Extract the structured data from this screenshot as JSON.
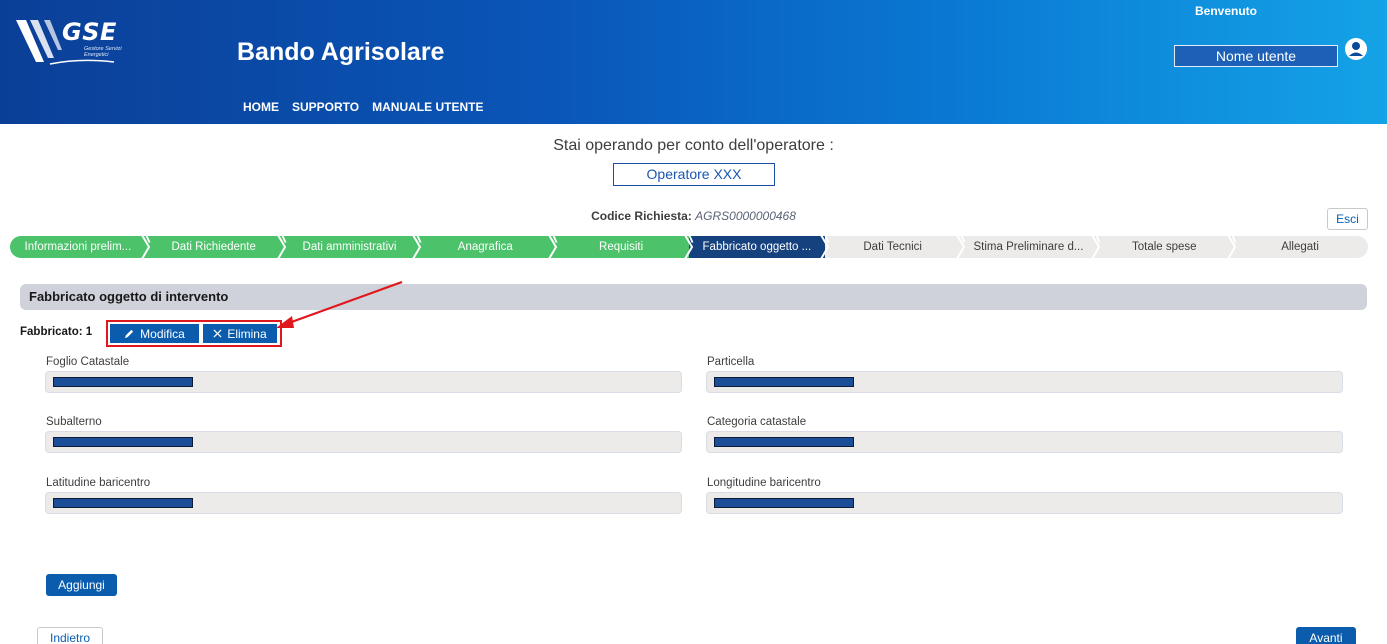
{
  "header": {
    "logo_text": "GSE",
    "logo_subtitle": "Gestore Servizi Energetici",
    "app_title": "Bando Agrisolare",
    "nav": [
      "HOME",
      "SUPPORTO",
      "MANUALE UTENTE"
    ],
    "welcome": "Benvenuto",
    "user_name": "Nome utente"
  },
  "operator": {
    "label": "Stai operando per conto dell'operatore :",
    "name": "Operatore XXX"
  },
  "request": {
    "code_label": "Codice Richiesta:",
    "code_value": "AGRS0000000468",
    "exit_label": "Esci"
  },
  "stepper": {
    "steps": [
      {
        "label": "Informazioni prelim...",
        "status": "done"
      },
      {
        "label": "Dati Richiedente",
        "status": "done"
      },
      {
        "label": "Dati amministrativi",
        "status": "done"
      },
      {
        "label": "Anagrafica",
        "status": "done"
      },
      {
        "label": "Requisiti",
        "status": "done"
      },
      {
        "label": "Fabbricato oggetto ...",
        "status": "current"
      },
      {
        "label": "Dati Tecnici",
        "status": "todo"
      },
      {
        "label": "Stima Preliminare d...",
        "status": "todo"
      },
      {
        "label": "Totale spese",
        "status": "todo"
      },
      {
        "label": "Allegati",
        "status": "todo"
      }
    ],
    "colors": {
      "done": "#4cc26a",
      "current": "#15417e",
      "todo": "#ecebea"
    }
  },
  "section": {
    "title": "Fabbricato oggetto di intervento",
    "fabbricato_label": "Fabbricato: 1",
    "modify_label": "Modifica",
    "delete_label": "Elimina"
  },
  "fields": {
    "foglio_catastale": "Foglio Catastale",
    "particella": "Particella",
    "subalterno": "Subalterno",
    "categoria_catastale": "Categoria catastale",
    "latitudine": "Latitudine baricentro",
    "longitudine": "Longitudine baricentro"
  },
  "actions": {
    "add": "Aggiungi",
    "back": "Indietro",
    "next": "Avanti"
  },
  "colors": {
    "primary": "#0b5cad",
    "highlight": "#e0171c",
    "redaction": "#1b4e97"
  }
}
